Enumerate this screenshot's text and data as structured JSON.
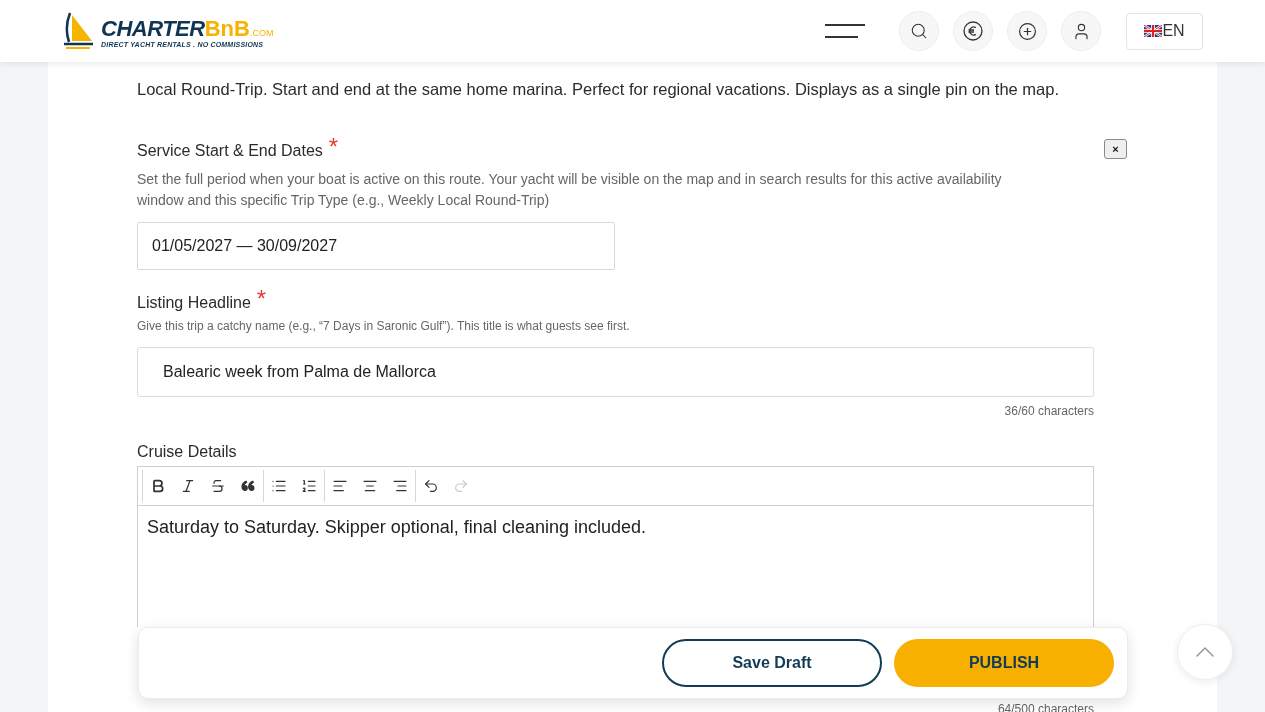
{
  "header": {
    "logo": {
      "brand_main": "CHARTER",
      "brand_accent": "BnB",
      "domain": ".COM",
      "tagline": "DIRECT YACHT RENTALS . NO COMMISSIONS"
    },
    "language": {
      "code": "EN"
    }
  },
  "intro": "Local Round-Trip. Start and end at the same home marina. Perfect for regional vacations. Displays as a single pin on the map.",
  "dates": {
    "label": "Service Start & End Dates",
    "required_mark": "*",
    "help": "Set the full period when your boat is active on this route. Your yacht will be visible on the map and in search results for this active availability window and this specific Trip Type (e.g., Weekly Local Round-Trip)",
    "value": "01/05/2027 — 30/09/2027",
    "remove_button": "×"
  },
  "headline": {
    "label": "Listing Headline",
    "required_mark": "*",
    "help": "Give this trip a catchy name (e.g., “7 Days in Saronic Gulf”). This title is what guests see first.",
    "value": "Balearic week from Palma de Mallorca",
    "counter": "36/60 characters"
  },
  "cruise_details": {
    "label": "Cruise Details",
    "toolbar": [
      {
        "items": [
          {
            "kind": "bold",
            "disabled": false
          },
          {
            "kind": "italic",
            "disabled": false
          },
          {
            "kind": "strikethrough",
            "disabled": false
          },
          {
            "kind": "quote",
            "disabled": false
          }
        ]
      },
      {
        "items": [
          {
            "kind": "bullet_list",
            "disabled": false
          },
          {
            "kind": "numbered_list",
            "disabled": false
          }
        ]
      },
      {
        "items": [
          {
            "kind": "align_left",
            "disabled": false
          },
          {
            "kind": "align_center",
            "disabled": false
          },
          {
            "kind": "align_right",
            "disabled": false
          }
        ]
      },
      {
        "items": [
          {
            "kind": "undo",
            "disabled": false
          },
          {
            "kind": "redo",
            "disabled": true
          }
        ]
      }
    ],
    "content": "Saturday to Saturday. Skipper optional, final cleaning included.",
    "counter": "64/500 characters"
  },
  "actions": [
    {
      "kind": "outline",
      "label": "Save Draft"
    },
    {
      "kind": "primary",
      "label": "PUBLISH"
    }
  ]
}
